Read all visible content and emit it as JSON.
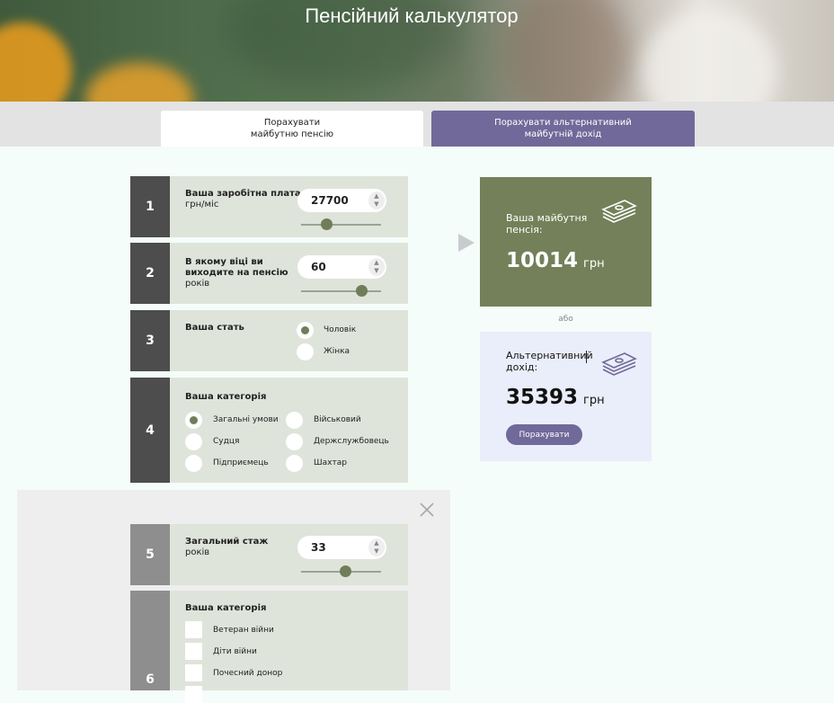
{
  "header": {
    "title": "Пенсійний калькулятор"
  },
  "tabs": [
    {
      "label": "Порахувати\nмайбутню пенсію",
      "active": true
    },
    {
      "label": "Порахувати альтернативний\nмайбутній дохід",
      "active": false
    }
  ],
  "steps": {
    "salary": {
      "number": "1",
      "label": "Ваша заробітна плата",
      "unit": "грн/міс",
      "value": "27700",
      "slider_fraction": 0.32
    },
    "age": {
      "number": "2",
      "label": "В якому віці ви виходите на пенсію",
      "unit": "років",
      "value": "60",
      "slider_fraction": 0.75
    },
    "gender": {
      "number": "3",
      "label": "Ваша стать",
      "options": [
        "Чоловік",
        "Жінка"
      ],
      "selected": "Чоловік"
    },
    "category": {
      "number": "4",
      "label": "Ваша категорія",
      "options": [
        "Загальні умови",
        "Військовий",
        "Судця",
        "Держслужбовець",
        "Підприємець",
        "Шахтар"
      ],
      "selected": "Загальні умови"
    },
    "experience": {
      "number": "5",
      "label": "Загальний стаж",
      "unit": "років",
      "value": "33",
      "slider_fraction": 0.55
    },
    "extra_category": {
      "number": "6",
      "label": "Ваша категорія",
      "options": [
        "Ветеран війни",
        "Діти війни",
        "Почесний донор"
      ]
    }
  },
  "results": {
    "pension": {
      "label": "Ваша майбутня пенсія:",
      "value": "10014",
      "unit": "грн",
      "icon": "money-stack-icon"
    },
    "separator": "або",
    "alternative": {
      "label": "Альтернативний дохід:",
      "value": "35393",
      "unit": "грн",
      "button": "Порахувати",
      "icon": "money-stack-icon"
    }
  },
  "colors": {
    "accent": "#716999",
    "olive": "#738059",
    "step_bg": "#dfe4da",
    "num_bg": "#4d4d4d"
  }
}
